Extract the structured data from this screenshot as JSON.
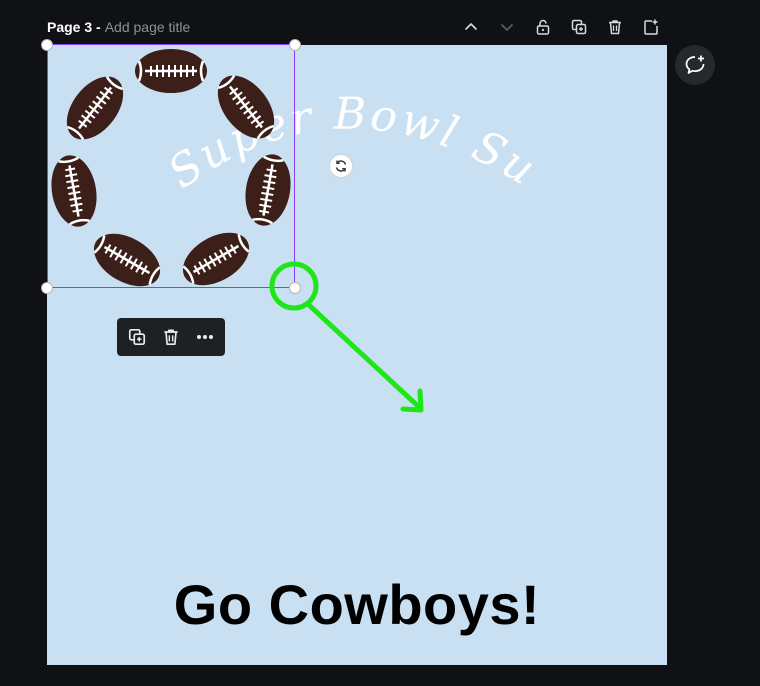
{
  "header": {
    "page_number": "Page 3 -",
    "title_placeholder": "Add page title",
    "actions": [
      {
        "name": "move-page-up",
        "icon": "chevron-up-icon"
      },
      {
        "name": "move-page-down",
        "icon": "chevron-down-icon"
      },
      {
        "name": "lock-page",
        "icon": "unlock-icon"
      },
      {
        "name": "duplicate-page",
        "icon": "duplicate-icon"
      },
      {
        "name": "delete-page",
        "icon": "trash-icon"
      },
      {
        "name": "add-page",
        "icon": "add-page-icon"
      }
    ]
  },
  "canvas": {
    "background": "#c9e0f3",
    "curved_text": "Super Bowl Sunday",
    "headline": "Go Cowboys!",
    "selected_element": "football-wreath-graphic",
    "football_color": "#3b1f18",
    "lace_color": "#ffffff"
  },
  "selection": {
    "border_color": "#8b3dff",
    "rotate_icon": "rotate-icon"
  },
  "context_toolbar": {
    "items": [
      {
        "name": "duplicate-element",
        "icon": "duplicate-icon"
      },
      {
        "name": "delete-element",
        "icon": "trash-icon"
      },
      {
        "name": "more-options",
        "icon": "more-dots-icon"
      }
    ]
  },
  "side_panel": {
    "comment_icon": "add-comment-icon"
  },
  "annotation": {
    "color": "#1ee619",
    "shape": "circle-with-arrow",
    "meaning": "drag bottom-right corner handle outward to resize"
  }
}
